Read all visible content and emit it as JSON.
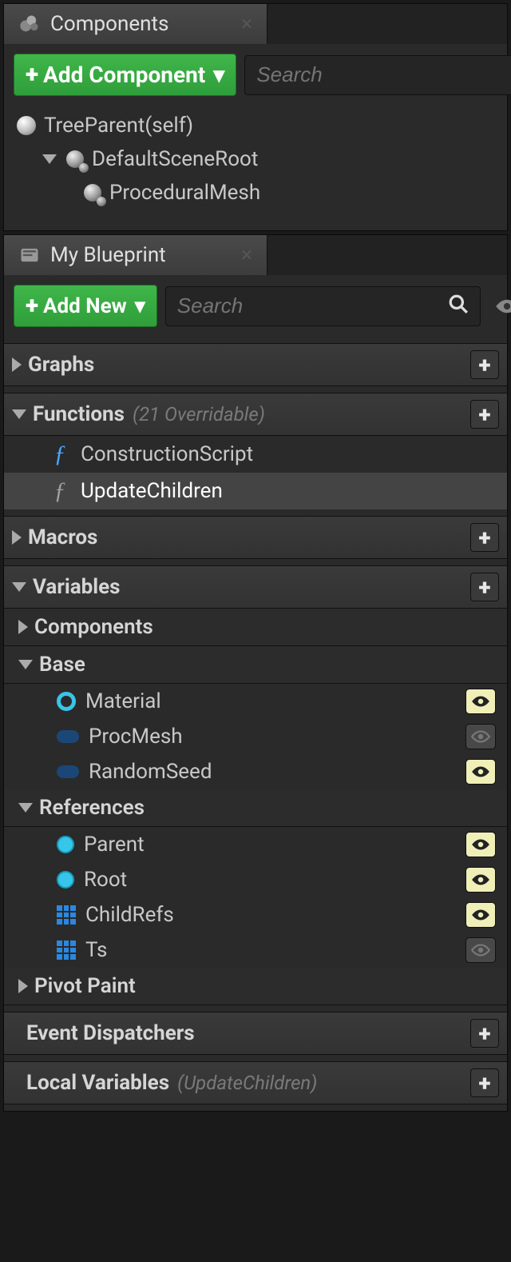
{
  "components": {
    "tab_title": "Components",
    "add_button": "Add Component",
    "search_placeholder": "Search",
    "tree": {
      "root": "TreeParent(self)",
      "scene_root": "DefaultSceneRoot",
      "child1": "ProceduralMesh"
    }
  },
  "blueprint": {
    "tab_title": "My Blueprint",
    "add_button": "Add New",
    "search_placeholder": "Search",
    "categories": {
      "graphs": {
        "label": "Graphs"
      },
      "functions": {
        "label": "Functions",
        "hint": "(21 Overridable)"
      },
      "macros": {
        "label": "Macros"
      },
      "variables": {
        "label": "Variables"
      },
      "event_dispatchers": {
        "label": "Event Dispatchers"
      },
      "local_variables": {
        "label": "Local Variables",
        "hint": "(UpdateChildren)"
      }
    },
    "functions": {
      "construction": "ConstructionScript",
      "update_children": "UpdateChildren"
    },
    "var_groups": {
      "components": "Components",
      "base": "Base",
      "references": "References",
      "pivot_paint": "Pivot Paint"
    },
    "vars": {
      "material": "Material",
      "procmesh": "ProcMesh",
      "randomseed": "RandomSeed",
      "parent": "Parent",
      "root": "Root",
      "childrefs": "ChildRefs",
      "ts": "Ts"
    }
  }
}
